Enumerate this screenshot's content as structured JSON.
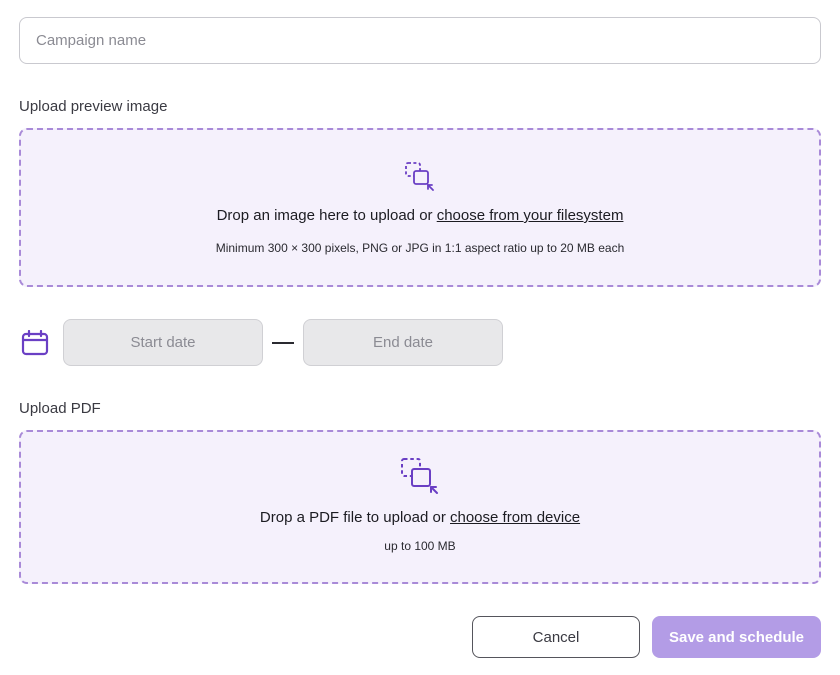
{
  "campaign": {
    "name_placeholder": "Campaign name",
    "name_value": ""
  },
  "preview_upload": {
    "label": "Upload preview image",
    "icon": "upload-copy-icon",
    "main_text": "Drop an image here to upload or ",
    "link_text": "choose from your filesystem",
    "hint": "Minimum 300 × 300 pixels, PNG or JPG in 1:1 aspect ratio up to 20 MB each"
  },
  "dates": {
    "icon": "calendar-icon",
    "start_placeholder": "Start date",
    "end_placeholder": "End date"
  },
  "pdf_upload": {
    "label": "Upload PDF",
    "icon": "upload-copy-icon",
    "main_text": "Drop a PDF file to upload or ",
    "link_text": "choose from device",
    "hint": "up to 100 MB"
  },
  "actions": {
    "cancel_label": "Cancel",
    "save_label": "Save and schedule"
  },
  "colors": {
    "accent": "#6a3fc4",
    "dropzone_border": "#a98ad8",
    "dropzone_bg": "#f5f1fc",
    "save_bg": "#b39ce6"
  }
}
